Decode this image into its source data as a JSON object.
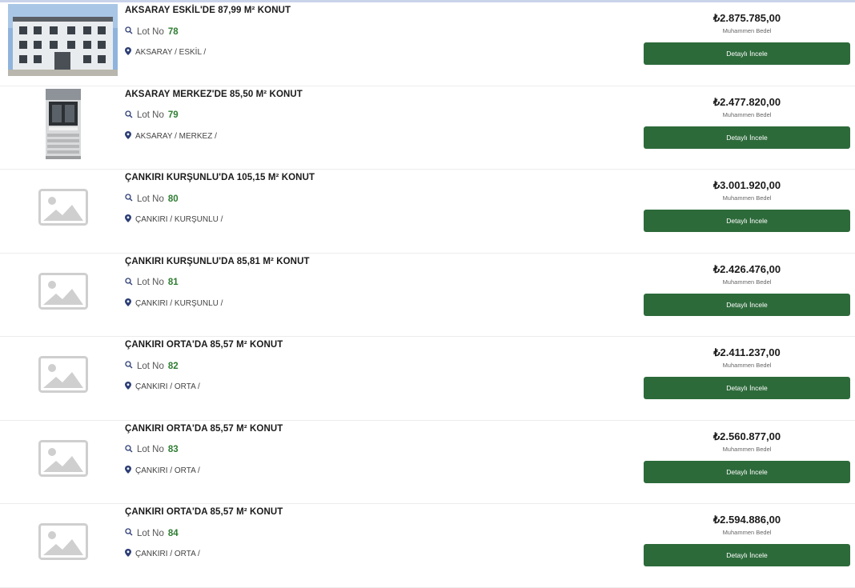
{
  "currency_symbol": "₺",
  "price_caption": "Muhammen Bedel",
  "button_label": "Detaylı İncele",
  "lot_prefix": "Lot No",
  "listings": [
    {
      "title": "AKSARAY ESKİL'DE 87,99 M² KONUT",
      "lot": "78",
      "location": "AKSARAY / ESKİL /",
      "price": "₺2.875.785,00",
      "image": "building-photo"
    },
    {
      "title": "AKSARAY MERKEZ'DE 85,50 M² KONUT",
      "lot": "79",
      "location": "AKSARAY / MERKEZ /",
      "price": "₺2.477.820,00",
      "image": "entrance-photo"
    },
    {
      "title": "ÇANKIRI KURŞUNLU'DA 105,15 M² KONUT",
      "lot": "80",
      "location": "ÇANKIRI / KURŞUNLU /",
      "price": "₺3.001.920,00",
      "image": "placeholder"
    },
    {
      "title": "ÇANKIRI KURŞUNLU'DA 85,81 M² KONUT",
      "lot": "81",
      "location": "ÇANKIRI / KURŞUNLU /",
      "price": "₺2.426.476,00",
      "image": "placeholder"
    },
    {
      "title": "ÇANKIRI ORTA'DA 85,57 M² KONUT",
      "lot": "82",
      "location": "ÇANKIRI / ORTA /",
      "price": "₺2.411.237,00",
      "image": "placeholder"
    },
    {
      "title": "ÇANKIRI ORTA'DA 85,57 M² KONUT",
      "lot": "83",
      "location": "ÇANKIRI / ORTA /",
      "price": "₺2.560.877,00",
      "image": "placeholder"
    },
    {
      "title": "ÇANKIRI ORTA'DA 85,57 M² KONUT",
      "lot": "84",
      "location": "ÇANKIRI / ORTA /",
      "price": "₺2.594.886,00",
      "image": "placeholder"
    }
  ],
  "colors": {
    "button_bg": "#2d6a3a",
    "lot_number": "#2e7d32",
    "location_pin": "#2c3e75"
  }
}
